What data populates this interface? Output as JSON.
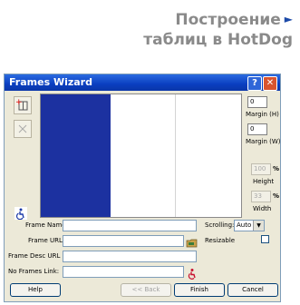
{
  "header": {
    "title_line1": "Построение",
    "title_line2": "таблиц в HotDog",
    "arrow": "►"
  },
  "window": {
    "title": "Frames Wizard",
    "help_glyph": "?",
    "close_glyph": "✕"
  },
  "right_panel": {
    "margin_h_value": "0",
    "margin_h_label": "Margin (H)",
    "margin_w_value": "0",
    "margin_w_label": "Margin (W)",
    "height_value": "100",
    "height_unit": "%",
    "height_label": "Height",
    "width_value": "33",
    "width_unit": "%",
    "width_label": "Width"
  },
  "form": {
    "frame_name_label": "Frame Name:",
    "frame_name_value": "",
    "frame_url_label": "Frame URL:",
    "frame_url_value": "",
    "frame_desc_label": "Frame Desc URL",
    "frame_desc_value": "",
    "no_frames_label": "No Frames Link:",
    "no_frames_value": "",
    "scrolling_label": "Scrolling:",
    "scrolling_value": "Auto",
    "resizable_label": "Resizable"
  },
  "buttons": {
    "help": "Help",
    "back": "<< Back",
    "finish": "Finish",
    "cancel": "Cancel"
  },
  "colors": {
    "selected_frame": "#1c31a0",
    "titlebar": "#0a3ec0",
    "header_text": "#8a8a8a"
  }
}
